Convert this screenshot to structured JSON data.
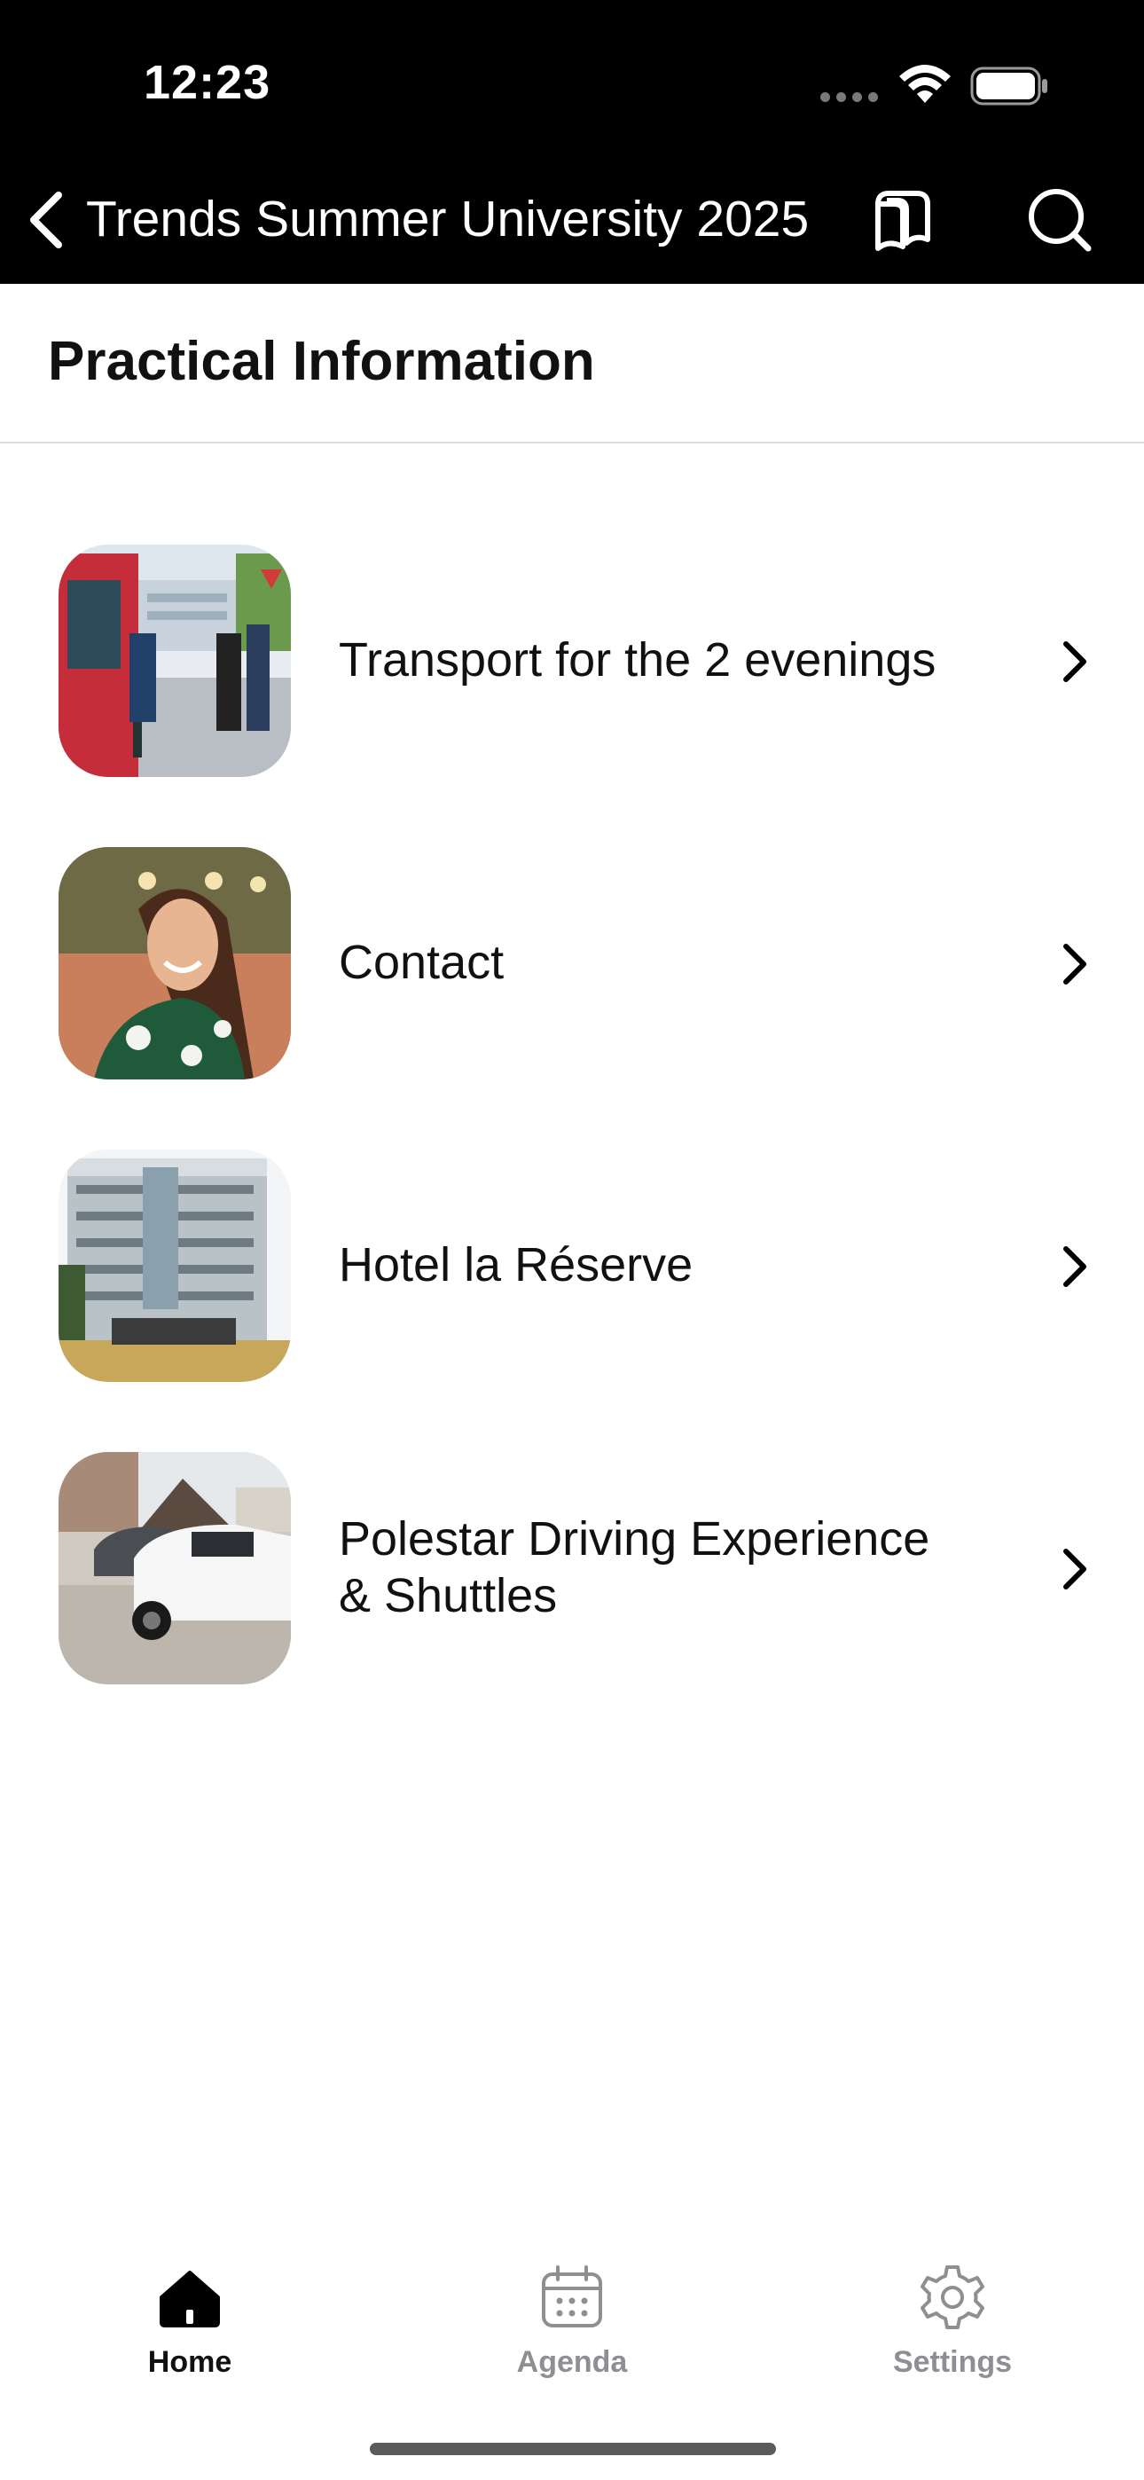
{
  "status_bar": {
    "time": "12:23"
  },
  "nav": {
    "title": "Trends Summer University 2025"
  },
  "page": {
    "title": "Practical Information"
  },
  "items": [
    {
      "label": "Transport for the 2 evenings",
      "image": "bus-boarding-photo"
    },
    {
      "label": "Contact",
      "image": "contact-person-portrait"
    },
    {
      "label": "Hotel la Réserve",
      "image": "hotel-building-photo"
    },
    {
      "label_line1": "Polestar Driving Experience",
      "label_line2": "& Shuttles",
      "image": "polestar-cars-photo"
    }
  ],
  "tabs": [
    {
      "label": "Home",
      "icon": "home-icon",
      "active": true
    },
    {
      "label": "Agenda",
      "icon": "calendar-icon",
      "active": false
    },
    {
      "label": "Settings",
      "icon": "gear-icon",
      "active": false
    }
  ],
  "colors": {
    "nav_bg": "#000000",
    "active_tab": "#111111",
    "inactive_tab": "#8e8e93"
  }
}
